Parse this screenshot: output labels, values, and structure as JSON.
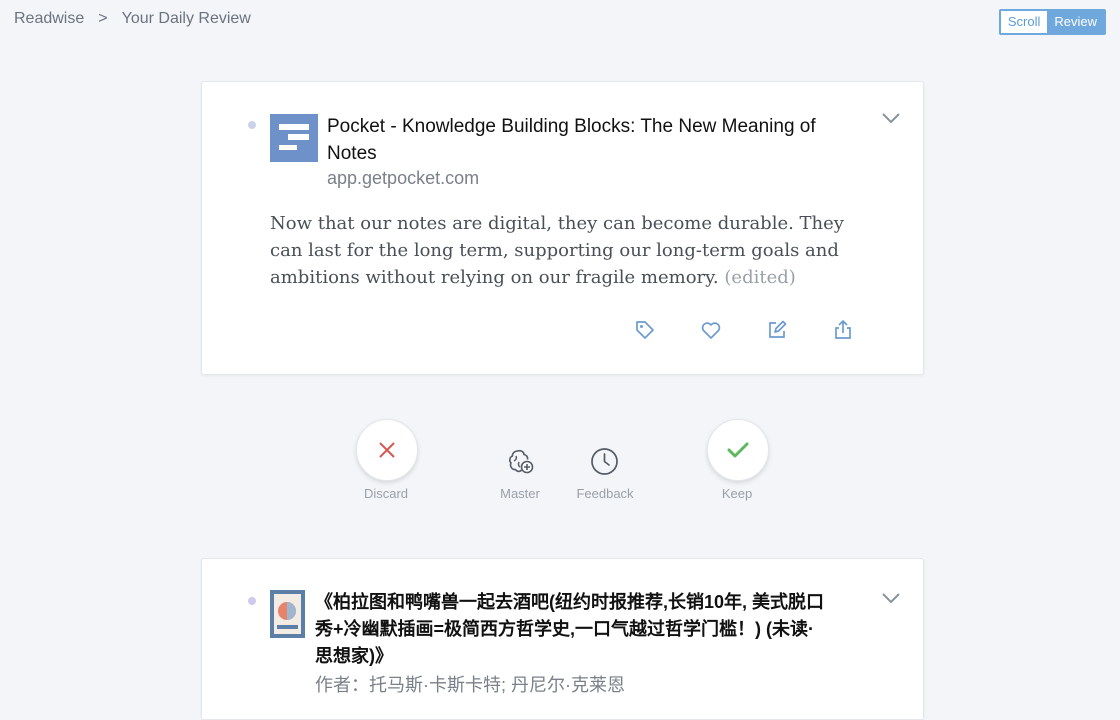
{
  "breadcrumb": {
    "root": "Readwise",
    "separator": ">",
    "current": "Your Daily Review"
  },
  "view_toggle": {
    "scroll": "Scroll",
    "review": "Review",
    "active": "Review"
  },
  "highlight": {
    "title": "Pocket - Knowledge Building Blocks: The New Meaning of Notes",
    "source": "app.getpocket.com",
    "text": "Now that our notes are digital, they can become durable. They can last for the long term, supporting our long-term goals and ambitions without relying on our fragile memory.",
    "edited_label": "(edited)",
    "actions": [
      "tag-icon",
      "heart-icon",
      "edit-icon",
      "share-icon"
    ]
  },
  "review_controls": {
    "discard": "Discard",
    "master": "Master",
    "feedback": "Feedback",
    "keep": "Keep"
  },
  "next_card": {
    "title": "《柏拉图和鸭嘴兽一起去酒吧(纽约时报推荐,长销10年, 美式脱口秀+冷幽默插画=极简西方哲学史,一口气越过哲学门槛！) (未读·思想家)》",
    "author": "作者：托马斯·卡斯卡特; 丹尼尔·克莱恩"
  },
  "colors": {
    "accent": "#6fa8dc",
    "discard": "#d9534f",
    "keep": "#5cb85c",
    "icon": "#6b9bd1"
  }
}
